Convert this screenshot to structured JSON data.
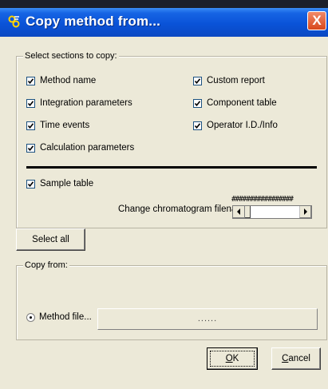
{
  "window": {
    "title": "Copy method from...",
    "close_glyph": "X"
  },
  "sections": {
    "legend": "Select sections to copy:",
    "checkboxes": [
      {
        "label": "Method name",
        "checked": true
      },
      {
        "label": "Integration parameters",
        "checked": true
      },
      {
        "label": "Time events",
        "checked": true
      },
      {
        "label": "Calculation parameters",
        "checked": true
      },
      {
        "label": "Custom report",
        "checked": true
      },
      {
        "label": "Component table",
        "checked": true
      },
      {
        "label": "Operator I.D./Info",
        "checked": true
      },
      {
        "label": "Sample table",
        "checked": true
      }
    ],
    "chromatogram_filename_value": "#################",
    "change_chromatogram_label": "Change chromatogram filename:"
  },
  "buttons": {
    "select_all": "Select all",
    "ok_underline": "O",
    "ok_rest": "K",
    "cancel_underline": "C",
    "cancel_rest": "ancel"
  },
  "copy_from": {
    "legend": "Copy from:",
    "method_file_label": "Method file...",
    "method_file_selected": true,
    "file_field_text": "......"
  },
  "icons": {
    "title_icon": "app-icon",
    "close_icon": "close-icon",
    "check_icon": "checkmark-icon",
    "scroll_left_icon": "arrow-left-icon",
    "scroll_right_icon": "arrow-right-icon"
  },
  "colors": {
    "titlebar": "#0a53d8",
    "close_button": "#d8471b",
    "dialog_background": "#ece9d8"
  }
}
